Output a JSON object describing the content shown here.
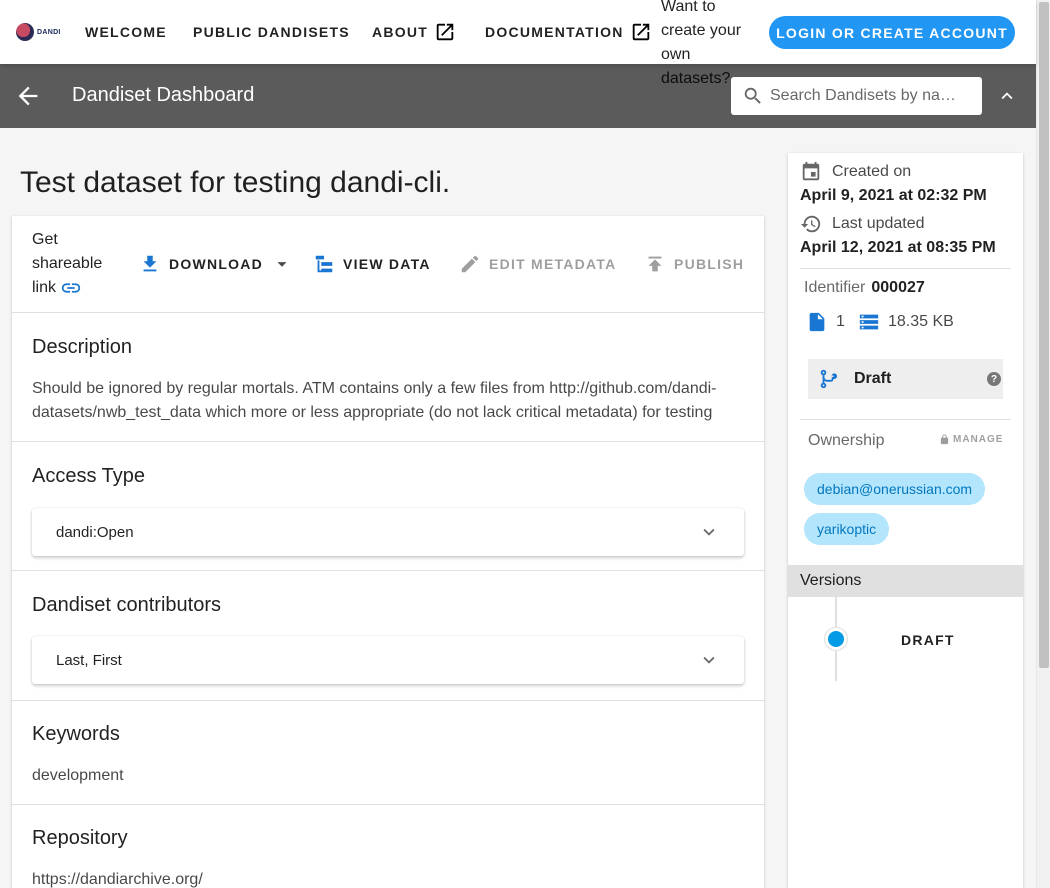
{
  "topbar": {
    "logo_text": "DANDI",
    "nav": {
      "welcome": "WELCOME",
      "public_dandisets": "PUBLIC DANDISETS",
      "about": "ABOUT",
      "documentation": "DOCUMENTATION"
    },
    "prompt": "Want to create your own datasets?",
    "login_label": "LOGIN OR CREATE ACCOUNT"
  },
  "dashbar": {
    "title": "Dandiset Dashboard",
    "search_placeholder": "Search Dandisets by na…"
  },
  "main": {
    "title": "Test dataset for testing dandi-cli.",
    "actions": {
      "share": "Get shareable link",
      "download": "DOWNLOAD",
      "view_data": "VIEW DATA",
      "edit_metadata": "EDIT METADATA",
      "publish": "PUBLISH"
    },
    "description": {
      "heading": "Description",
      "text": "Should be ignored by regular mortals. ATM contains only a few files from http://github.com/dandi-datasets/nwb_test_data which more or less appropriate (do not lack critical metadata) for testing"
    },
    "access_type": {
      "heading": "Access Type",
      "value": "dandi:Open"
    },
    "contributors": {
      "heading": "Dandiset contributors",
      "value": "Last, First"
    },
    "keywords": {
      "heading": "Keywords",
      "value": "development"
    },
    "repository": {
      "heading": "Repository",
      "value": "https://dandiarchive.org/"
    }
  },
  "info": {
    "created_label": "Created on",
    "created_value": "April 9, 2021 at 02:32 PM",
    "updated_label": "Last updated",
    "updated_value": "April 12, 2021 at 08:35 PM",
    "identifier_label": "Identifier",
    "identifier_value": "000027",
    "file_count": "1",
    "size": "18.35 KB",
    "version_status": "Draft",
    "ownership_label": "Ownership",
    "manage_label": "MANAGE",
    "owners": [
      "debian@onerussian.com",
      "yarikoptic"
    ],
    "versions_label": "Versions",
    "versions": [
      "DRAFT"
    ]
  },
  "colors": {
    "accent": "#2196f3",
    "dashbar": "#5b5b5b",
    "chip_bg": "#b3e5fc",
    "chip_text": "#0277bd"
  }
}
